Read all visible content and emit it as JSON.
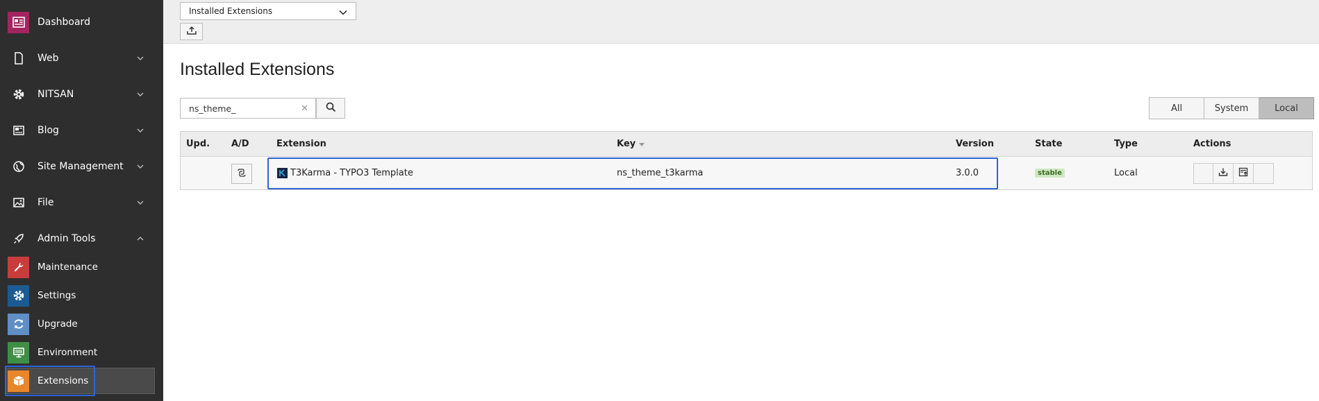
{
  "sidebar": {
    "dashboard": "Dashboard",
    "web": "Web",
    "nitsan": "NITSAN",
    "blog": "Blog",
    "site_management": "Site Management",
    "file": "File",
    "admin_tools": "Admin Tools",
    "modules": {
      "maintenance": "Maintenance",
      "settings": "Settings",
      "upgrade": "Upgrade",
      "environment": "Environment",
      "extensions": "Extensions"
    },
    "active_item": "Extensions"
  },
  "topbar": {
    "view_select": "Installed Extensions"
  },
  "main": {
    "title": "Installed Extensions",
    "search_value": "ns_theme_",
    "filters": [
      "All",
      "System",
      "Local"
    ],
    "active_filter": "Local"
  },
  "table": {
    "columns": {
      "upd": "Upd.",
      "ad": "A/D",
      "extension": "Extension",
      "key": "Key",
      "version": "Version",
      "state": "State",
      "type": "Type",
      "actions": "Actions"
    },
    "rows": [
      {
        "extension": "T3Karma - TYPO3 Template",
        "key": "ns_theme_t3karma",
        "version": "3.0.0",
        "state": "stable",
        "type": "Local"
      }
    ]
  },
  "colors": {
    "sidebar_bg": "#2e2e2e",
    "highlight": "#2f64d8",
    "dashboard_tile": "#a3245f",
    "maintenance_tile": "#c83c3c",
    "settings_tile": "#1d5a91",
    "upgrade_tile": "#5f8fc5",
    "environment_tile": "#3f8f46",
    "extensions_tile": "#e8862b",
    "stable_badge_bg": "#cfe8c2"
  }
}
